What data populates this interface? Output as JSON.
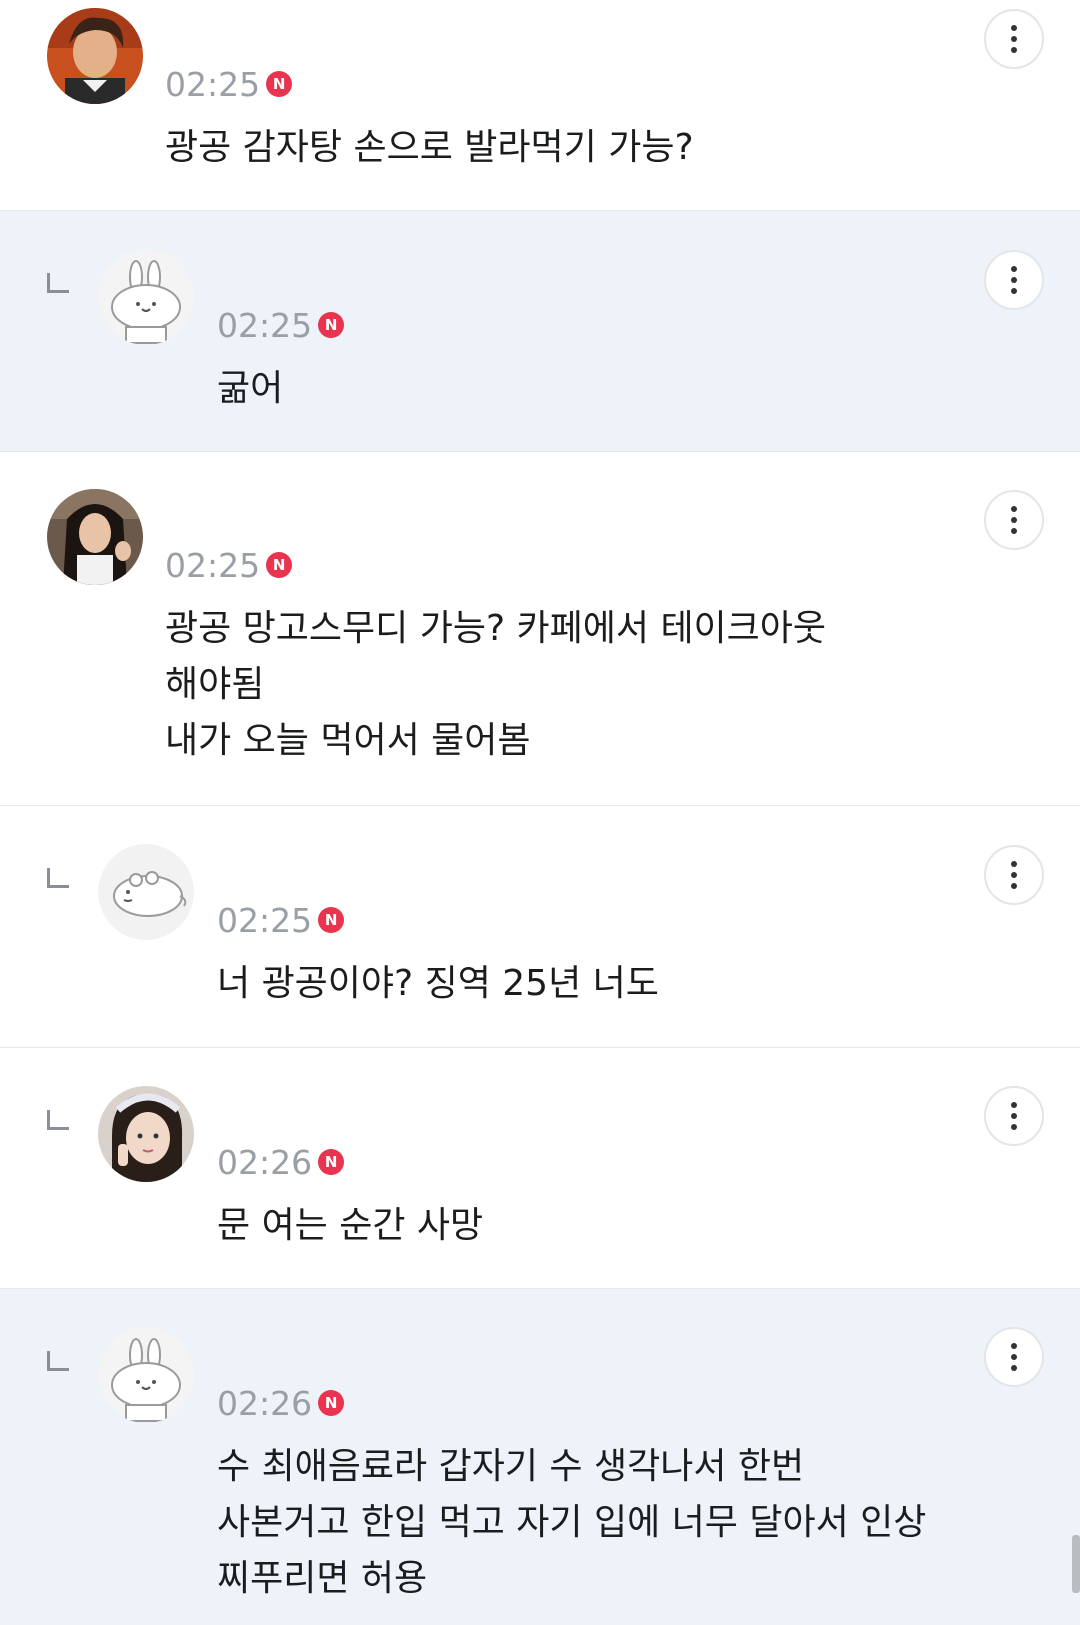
{
  "comments": [
    {
      "time": "02:25",
      "badge": "N",
      "lines": [
        "광공 감자탕 손으로 발라먹기 가능?"
      ]
    },
    {
      "time": "02:25",
      "badge": "N",
      "lines": [
        "굶어"
      ]
    },
    {
      "time": "02:25",
      "badge": "N",
      "lines": [
        "광공 망고스무디 가능? 카페에서 테이크아웃",
        "해야됨",
        "내가 오늘 먹어서 물어봄"
      ]
    },
    {
      "time": "02:25",
      "badge": "N",
      "lines": [
        "너 광공이야? 징역 25년 너도"
      ]
    },
    {
      "time": "02:26",
      "badge": "N",
      "lines": [
        "문 여는 순간 사망"
      ]
    },
    {
      "time": "02:26",
      "badge": "N",
      "lines": [
        "수 최애음료라 갑자기 수 생각나서 한번",
        "사본거고 한입 먹고 자기 입에 너무 달아서 인상",
        "찌푸리면 허용"
      ]
    }
  ],
  "icons": {
    "more": "more-vertical-icon",
    "reply": "reply-arrow-icon",
    "new": "new-badge-icon"
  },
  "colors": {
    "highlight_bg": "#eef2f9",
    "badge_red": "#e8344e",
    "time_gray": "#9a9ea5"
  }
}
